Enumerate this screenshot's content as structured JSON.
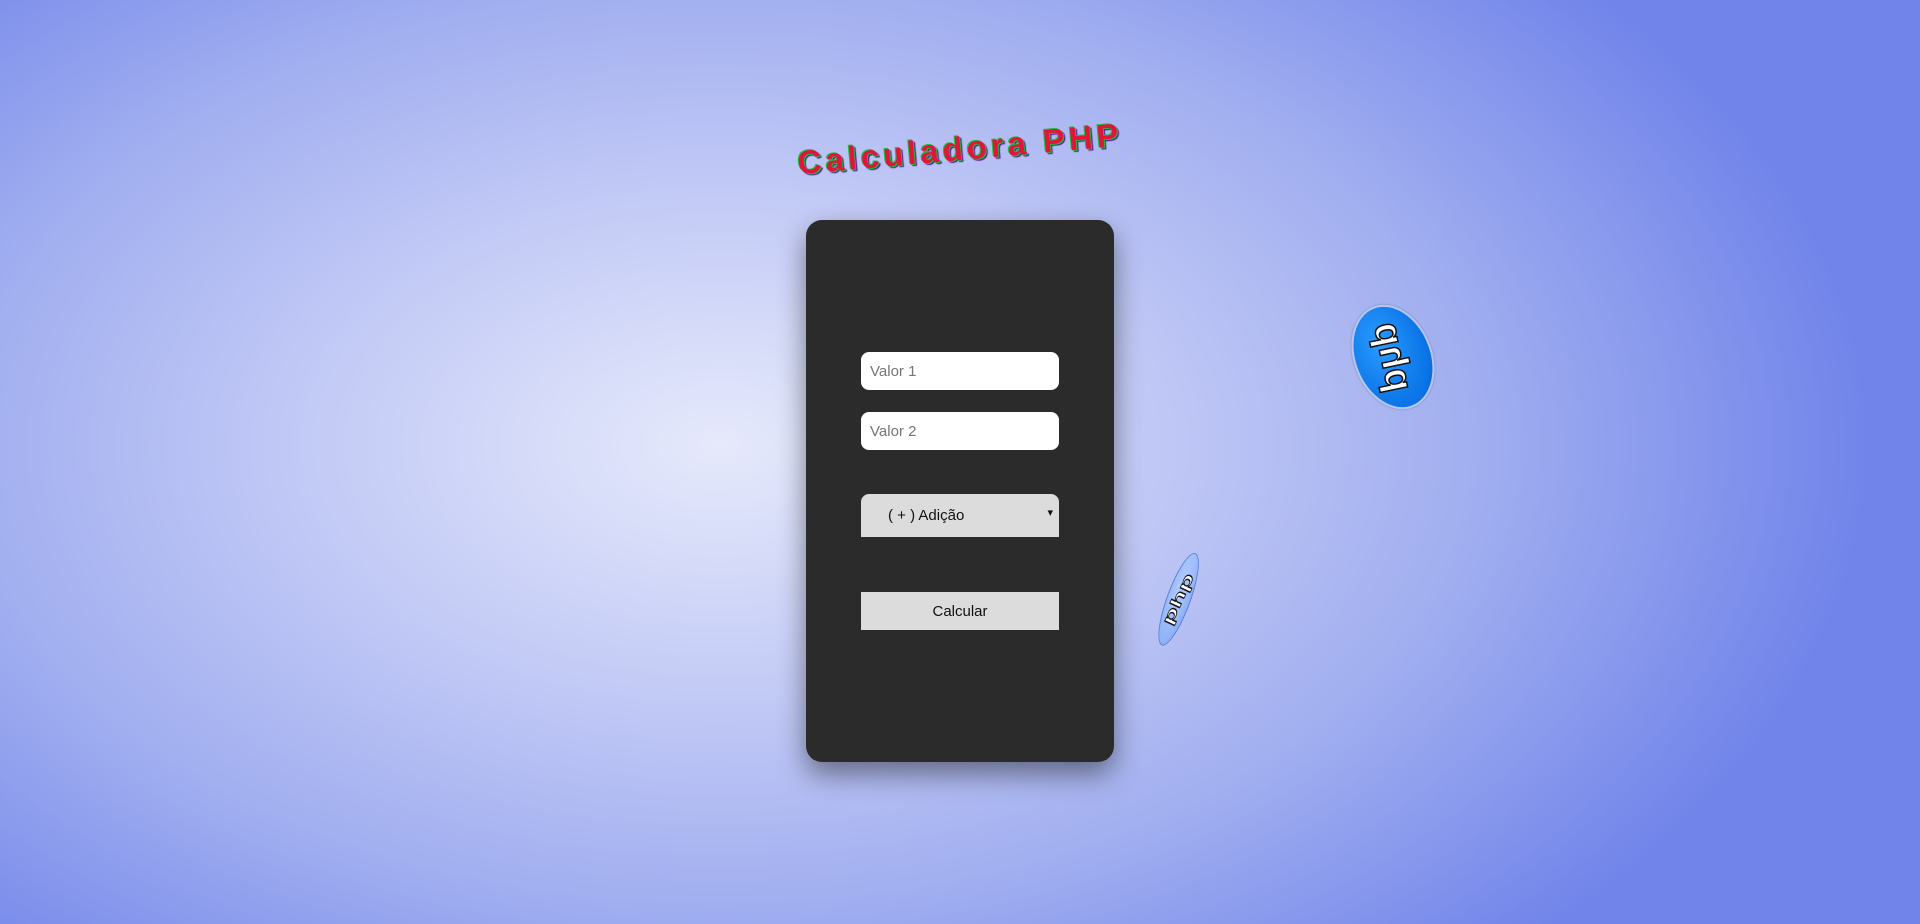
{
  "title": "Calculadora PHP",
  "form": {
    "value1_placeholder": "Valor 1",
    "value2_placeholder": "Valor 2",
    "operation": {
      "selected": "( + ) Adição",
      "arrow": "▾"
    },
    "submit_label": "Calcular"
  },
  "logos": {
    "large_text": "php",
    "small_text": "php"
  },
  "colors": {
    "card": "#2b2b2b",
    "title_fill": "#e0143c",
    "title_outline": "#1cbf3a",
    "logo_blue": "#0a73e6",
    "control_gray": "#dcdcdc"
  }
}
